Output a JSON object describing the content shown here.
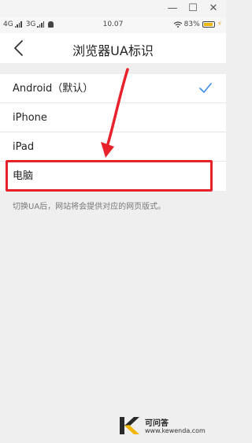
{
  "window": {
    "minimize_icon": "minimize-icon",
    "maximize_icon": "maximize-icon",
    "close_icon": "close-icon"
  },
  "status_bar": {
    "network_left": "4G",
    "network_right": "3G",
    "time": "10.07",
    "battery": "83%"
  },
  "nav": {
    "back_icon": "chevron-left-icon",
    "title": "浏览器UA标识"
  },
  "ua_options": [
    {
      "label": "Android（默认）",
      "selected": true
    },
    {
      "label": "iPhone",
      "selected": false
    },
    {
      "label": "iPad",
      "selected": false
    },
    {
      "label": "电脑",
      "selected": false
    }
  ],
  "hint": "切换UA后，网站将会提供对应的网页版式。",
  "colors": {
    "accent": "#3c8ee8",
    "annotation_red": "#e8222b",
    "background": "#efefef"
  },
  "watermark": {
    "name": "可问答",
    "url": "www.kewenda.com"
  }
}
